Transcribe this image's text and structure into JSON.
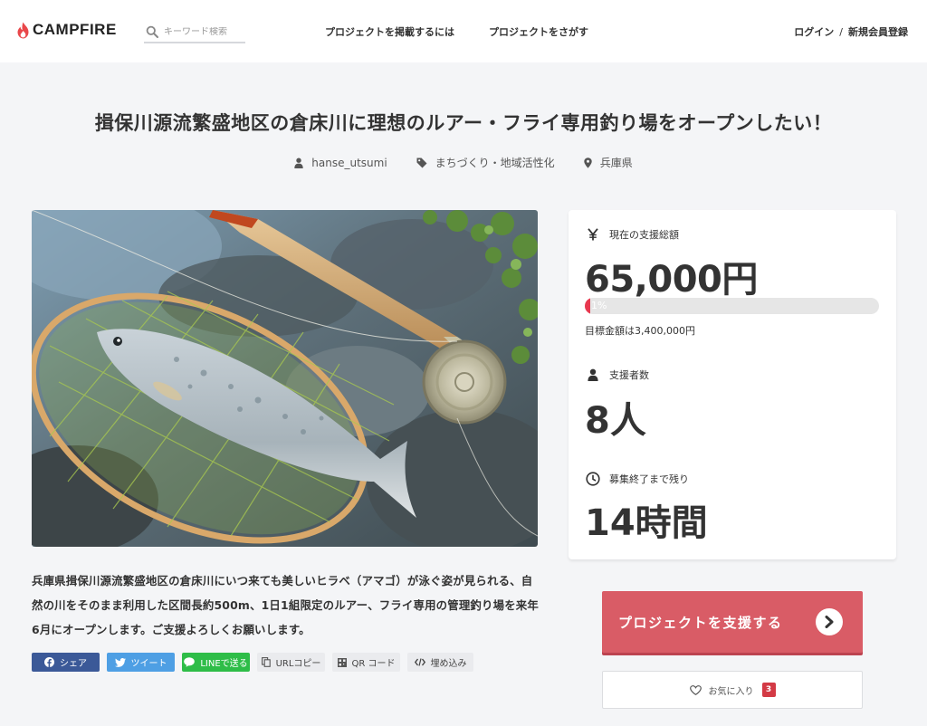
{
  "header": {
    "brand": "CAMPFIRE",
    "search_placeholder": "キーワード検索",
    "nav_post": "プロジェクトを掲載するには",
    "nav_find": "プロジェクトをさがす",
    "login": "ログイン",
    "separator": "/",
    "signup": "新規会員登録"
  },
  "project": {
    "title": "揖保川源流繁盛地区の倉床川に理想のルアー・フライ専用釣り場をオープンしたい！",
    "owner": "hanse_utsumi",
    "category": "まちづくり・地域活性化",
    "location": "兵庫県",
    "description": "兵庫県揖保川源流繁盛地区の倉床川にいつ来ても美しいヒラベ（アマゴ）が泳ぐ姿が見られる、自然の川をそのまま利用した区間長約500m、1日1組限定のルアー、フライ専用の管理釣り場を来年6月にオープンします。ご支援よろしくお願いします。"
  },
  "share": {
    "facebook": "シェア",
    "twitter": "ツイート",
    "line": "LINEで送る",
    "url_copy": "URLコピー",
    "qr": "QR コード",
    "embed": "埋め込み"
  },
  "stats": {
    "amount_label": "現在の支援総額",
    "amount": "65,000円",
    "progress_text": "1%",
    "progress_fraction": 0.019,
    "goal": "目標金額は3,400,000円",
    "backers_label": "支援者数",
    "backers": "8人",
    "remain_label": "募集終了まで残り",
    "remain": "14時間"
  },
  "actions": {
    "support": "プロジェクトを支援する",
    "favorite": "お気に入り",
    "favorite_count": "3"
  },
  "icons": {
    "brand": "flame-icon",
    "search": "search-icon",
    "owner": "user-icon",
    "category": "tag-icon",
    "location": "map-pin-icon",
    "amount": "yen-icon",
    "backers": "user-icon",
    "remain": "clock-icon",
    "support": "chevron-right-icon",
    "favorite": "heart-icon"
  },
  "colors": {
    "accent": "#d95c66",
    "progress": "#e8384f",
    "facebook": "#3b5998",
    "twitter": "#4e9fe4",
    "line": "#2ebd48",
    "badge": "#d33a45"
  }
}
